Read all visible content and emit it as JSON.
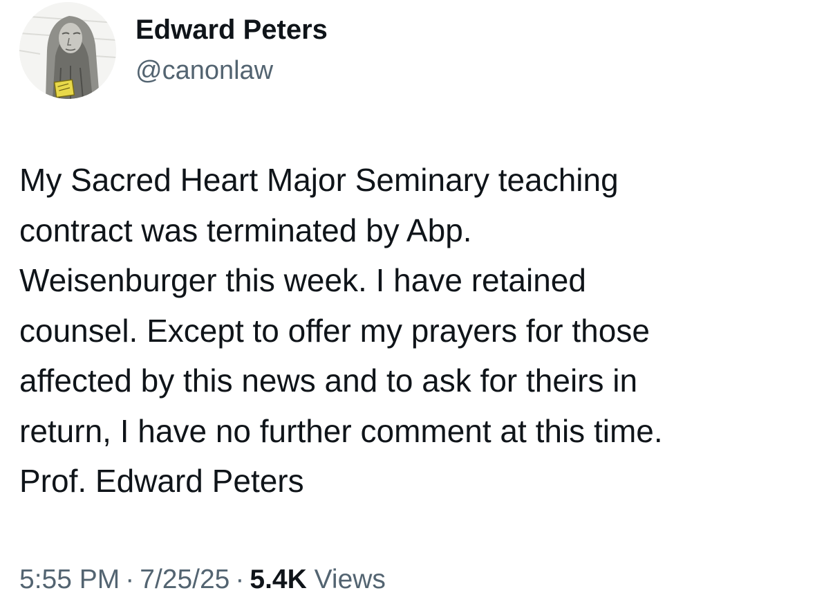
{
  "author": {
    "display_name": "Edward Peters",
    "handle": "@canonlaw",
    "avatar_icon": "portrait-avatar-icon"
  },
  "tweet": {
    "text": "My Sacred Heart Major Seminary teaching\ncontract was terminated by Abp.\nWeisenburger this week. I have retained\ncounsel. Except to offer my prayers for those\naffected by this news and to ask for theirs in\nreturn, I have no further comment at this time.\nProf. Edward Peters"
  },
  "meta": {
    "time": "5:55 PM",
    "separator": "·",
    "date": "7/25/25",
    "views_count": "5.4K",
    "views_label": "Views"
  },
  "colors": {
    "text_primary": "#0f1419",
    "text_secondary": "#536471",
    "background": "#ffffff"
  }
}
